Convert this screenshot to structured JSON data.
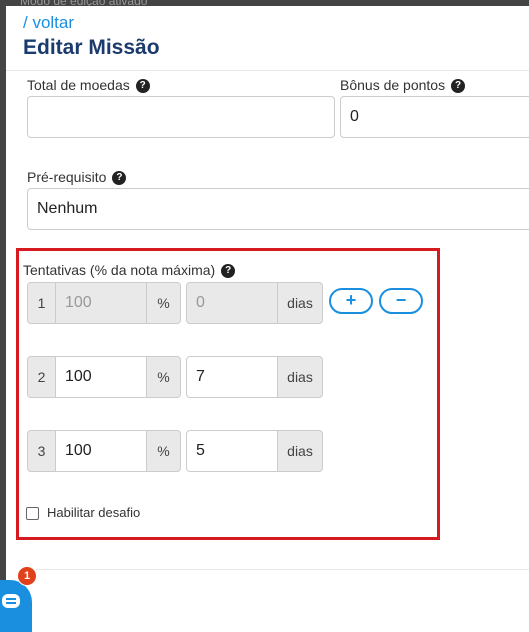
{
  "background": {
    "text": "Modo de edição ativado"
  },
  "header": {
    "back_label": "/ voltar",
    "title": "Editar Missão"
  },
  "fields": {
    "total_moedas": {
      "label": "Total de moedas",
      "value": ""
    },
    "bonus_pontos": {
      "label": "Bônus de pontos",
      "value": "0"
    },
    "pre_requisito": {
      "label": "Pré-requisito",
      "value": "Nenhum"
    }
  },
  "tentativas": {
    "label": "Tentativas (% da nota máxima)",
    "percent_symbol": "%",
    "days_unit": "dias",
    "rows": [
      {
        "index": "1",
        "percent": "100",
        "days": "0"
      },
      {
        "index": "2",
        "percent": "100",
        "days": "7"
      },
      {
        "index": "3",
        "percent": "100",
        "days": "5"
      }
    ],
    "add_label": "+",
    "remove_label": "−"
  },
  "challenge": {
    "label": "Habilitar desafio",
    "checked": false
  },
  "chat": {
    "badge_count": "1"
  },
  "colors": {
    "accent": "#1a8fe0",
    "title": "#1b3b6f",
    "highlight": "#d71920",
    "badge": "#e0401a"
  }
}
